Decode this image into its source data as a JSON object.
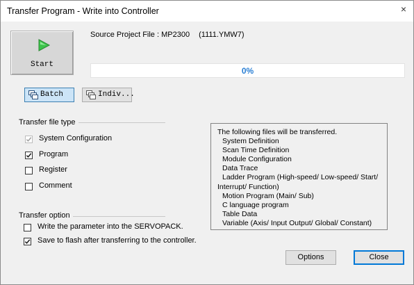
{
  "window": {
    "title": "Transfer Program - Write into Controller",
    "close_glyph": "×"
  },
  "start_button": {
    "label": "Start",
    "icon": "play-icon",
    "icon_color": "#3cc34a"
  },
  "source": {
    "label": "Source Project File : MP2300",
    "file": "(1111.YMW7)"
  },
  "progress": {
    "value": 0,
    "text": "0%",
    "text_color": "#2a7fd4"
  },
  "mode_buttons": {
    "batch": {
      "label": "Batch",
      "selected": true
    },
    "individual": {
      "label": "Indiv...",
      "selected": false
    }
  },
  "transfer_file_type": {
    "title": "Transfer file type",
    "items": [
      {
        "label": "System Configuration",
        "checked": true,
        "disabled": true
      },
      {
        "label": "Program",
        "checked": true,
        "disabled": false
      },
      {
        "label": "Register",
        "checked": false,
        "disabled": false
      },
      {
        "label": "Comment",
        "checked": false,
        "disabled": false
      }
    ]
  },
  "transfer_option": {
    "title": "Transfer option",
    "items": [
      {
        "label": "Write the parameter into the SERVOPACK.",
        "checked": false
      },
      {
        "label": "Save to flash after transferring to the controller.",
        "checked": true
      }
    ]
  },
  "info": {
    "heading": "The following files will be transferred.",
    "lines": [
      "System Definition",
      "Scan Time Definition",
      "Module Configuration",
      "Data Trace",
      "Ladder Program (High-speed/ Low-speed/ Start/",
      "Interrupt/ Function)",
      "Motion Program (Main/ Sub)",
      "C language program",
      "Table Data",
      "Variable (Axis/ Input Output/ Global/ Constant)"
    ]
  },
  "buttons": {
    "options": "Options",
    "close": "Close"
  },
  "colors": {
    "accent": "#0078d7",
    "check": "#1a1a1a",
    "check_disabled": "#a0a0a0"
  }
}
